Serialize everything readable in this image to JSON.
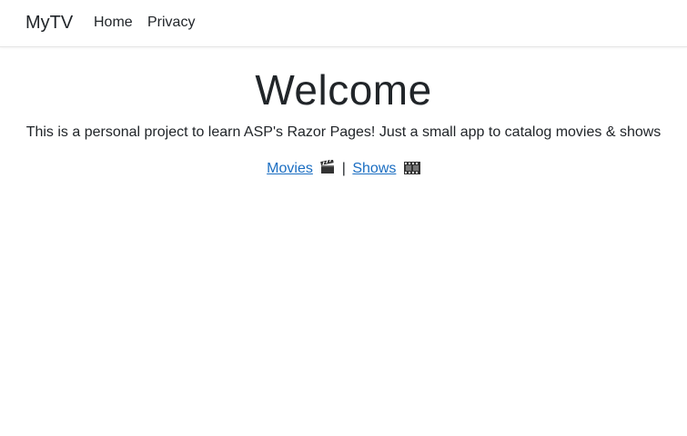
{
  "navbar": {
    "brand": "MyTV",
    "items": [
      {
        "label": "Home"
      },
      {
        "label": "Privacy"
      }
    ]
  },
  "main": {
    "title": "Welcome",
    "description": "This is a personal project to learn ASP's Razor Pages! Just a small app to catalog movies & shows",
    "links": {
      "movies_label": "Movies",
      "movies_icon": "clapper-board-icon",
      "separator": "|",
      "shows_label": "Shows",
      "shows_icon": "film-frames-icon"
    }
  },
  "colors": {
    "link": "#1b6ec2",
    "text": "#212529",
    "border": "#e5e5e5"
  }
}
